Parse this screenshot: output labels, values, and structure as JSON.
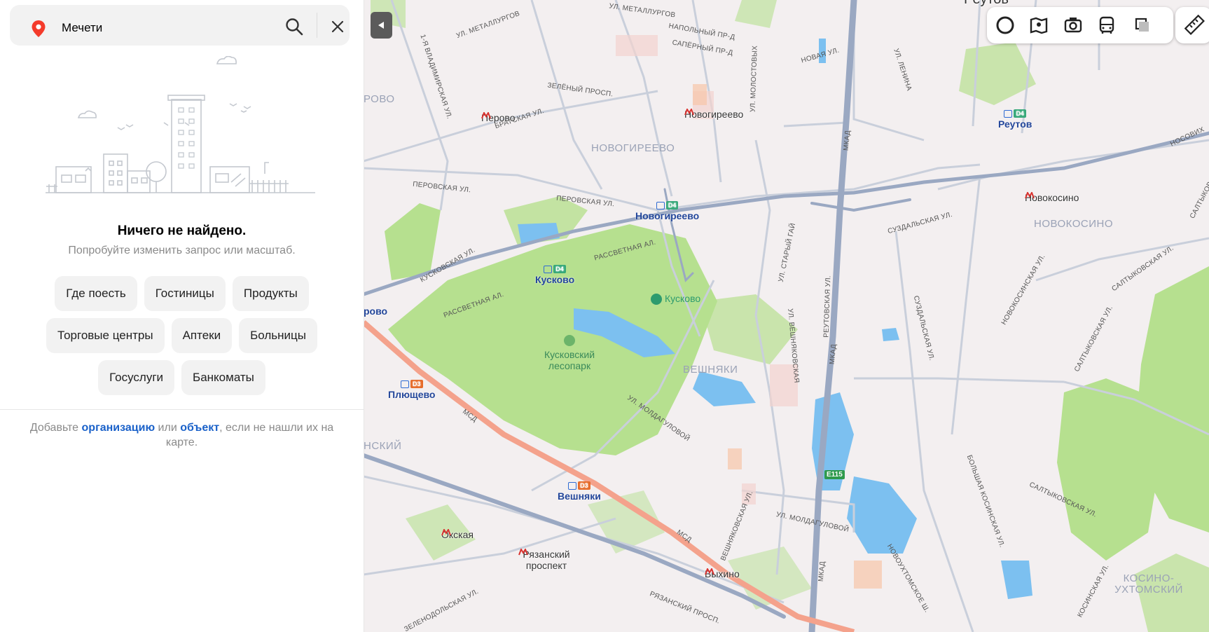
{
  "search": {
    "query": "Мечети",
    "pin_color": "#f43b2b"
  },
  "empty_state": {
    "title": "Ничего не найдено.",
    "subtitle": "Попробуйте изменить запрос или масштаб."
  },
  "categories_row1": [
    "Где поесть",
    "Гостиницы",
    "Продукты"
  ],
  "categories_row2": [
    "Торговые центры",
    "Аптеки",
    "Больницы"
  ],
  "categories_row3": [
    "Госуслуги",
    "Банкоматы"
  ],
  "add_note": {
    "prefix": "Добавьте ",
    "link1": "организацию",
    "middle": " или ",
    "link2": "объект",
    "suffix": ", если не нашли их на карте."
  },
  "map": {
    "colors": {
      "park": "#b6e08f",
      "water": "#7cc0f0",
      "road": "#c9cfdb",
      "highway": "#9aa8c2",
      "msd": "#f4a28c"
    },
    "streets": [
      "УЛ. МЕТАЛЛУРГОВ",
      "УЛ. МЕТАЛЛУРГОВ",
      "НАПОЛЬНЫЙ ПР-Д",
      "САПЁРНЫЙ ПР-Д",
      "1-Я ВЛАДИМИРСКАЯ УЛ.",
      "ЗЕЛЁНЫЙ ПРОСП.",
      "БРАТСКАЯ УЛ.",
      "УЛ. МОЛОСТОВЫХ",
      "НОВАЯ УЛ.",
      "УЛ. ЛЕНИНА",
      "НОСОВИХ",
      "ПЕРОВСКАЯ УЛ.",
      "ПЕРОВСКАЯ УЛ.",
      "РАССВЕТНАЯ АЛ.",
      "КУСКОВСКАЯ УЛ.",
      "РАССВЕТНАЯ АЛ.",
      "УЛ. СТАРЫЙ ГАЙ",
      "СУЗДАЛЬСКАЯ УЛ.",
      "САЛТЫКОВСКАЯ",
      "НОВОКОСИНСКАЯ УЛ.",
      "САЛТЫКОВСКАЯ УЛ.",
      "РЕУТОВСКАЯ УЛ.",
      "УЛ. ВЕШНЯКОВСКАЯ",
      "СУЗДАЛЬСКАЯ УЛ.",
      "САЛТЫКОВСКАЯ УЛ.",
      "МКАД",
      "МКАД",
      "МКАД",
      "МСД",
      "МСД",
      "УЛ. МОЛДАГУЛОВОЙ",
      "УЛ. МОЛДАГУЛОВОЙ",
      "ВЕШНЯКОВСКАЯ УЛ.",
      "БОЛЬШАЯ КОСИНСКАЯ УЛ.",
      "САЛТЫКОВСКАЯ УЛ.",
      "НОВОУХТОМСКОЕ Ш.",
      "РЯЗАНСКИЙ ПРОСП.",
      "ЗЕЛЕНОДОЛЬСКАЯ УЛ.",
      "КОСИНСКАЯ УЛ.",
      "E115"
    ],
    "places": [
      "Перово",
      "Новогиреево",
      "Новокосино",
      "Выхино",
      "Окская",
      "Рязанский проспект",
      "Реутов"
    ],
    "districts": [
      "НОВОГИРЕЕВО",
      "НОВОКОСИНО",
      "ВЕШНЯКИ",
      "КОСИНО-УХТОМСКИЙ",
      "РОВО",
      "НСКИЙ"
    ],
    "stations": [
      "Новогиреево",
      "Кусково",
      "Реутов",
      "Плющево",
      "Вешняки",
      "рово"
    ],
    "badges": {
      "d4": "D4",
      "d3": "D3"
    },
    "poi_kuskovo": "Кусково",
    "park_name": "Кусковский лесопарк",
    "top_cut_label": "Реутов"
  }
}
